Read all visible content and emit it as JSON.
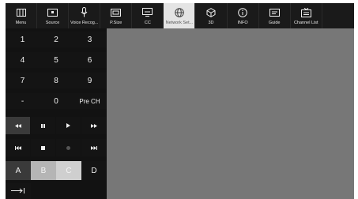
{
  "menu": [
    {
      "label": "Menu",
      "icon": "menu-icon"
    },
    {
      "label": "Source",
      "icon": "source-icon"
    },
    {
      "label": "Voice Recog...",
      "icon": "microphone-icon"
    },
    {
      "label": "P.Size",
      "icon": "picture-size-icon"
    },
    {
      "label": "CC",
      "icon": "closed-caption-icon"
    },
    {
      "label": "Network Set...",
      "icon": "globe-icon"
    },
    {
      "label": "3D",
      "icon": "3d-icon"
    },
    {
      "label": "INFO",
      "icon": "info-icon"
    },
    {
      "label": "Guide",
      "icon": "guide-icon"
    },
    {
      "label": "Channel List",
      "icon": "channel-list-icon"
    }
  ],
  "active_menu": "Network Set...",
  "keypad": {
    "digits": [
      "1",
      "2",
      "3",
      "4",
      "5",
      "6",
      "7",
      "8",
      "9"
    ],
    "dash": "-",
    "zero": "0",
    "prech": "Pre CH",
    "colors": [
      "A",
      "B",
      "C",
      "D"
    ]
  },
  "transport_icons": [
    "rewind-icon",
    "pause-icon",
    "play-icon",
    "fast-forward-icon",
    "skip-back-icon",
    "stop-icon",
    "record-icon",
    "skip-forward-icon"
  ],
  "tab_icon": "tab-icon"
}
